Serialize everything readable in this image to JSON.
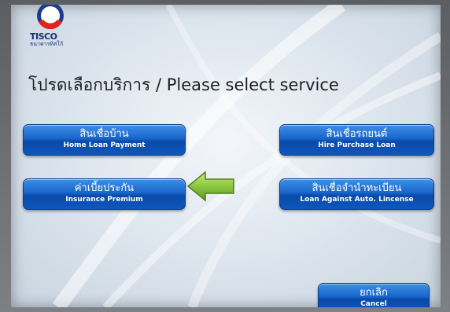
{
  "brand": {
    "name": "TISCO",
    "name_thai": "ธนาคารทิสโก้"
  },
  "header": {
    "title": "โปรดเลือกบริการ / Please select service"
  },
  "services": [
    {
      "label_th": "สินเชื่อบ้าน",
      "label_en": "Home Loan Payment"
    },
    {
      "label_th": "สินเชื่อรถยนต์",
      "label_en": "Hire Purchase Loan"
    },
    {
      "label_th": "ค่าเบี้ยประกัน",
      "label_en": "Insurance Premium"
    },
    {
      "label_th": "สินเชื่อจำนำทะเบียน",
      "label_en": "Loan Against Auto. Lincense"
    }
  ],
  "cancel": {
    "label_th": "ยกเลิก",
    "label_en": "Cancel"
  },
  "colors": {
    "button": "#1966cc",
    "arrow": "#8cc63f",
    "brand": "#17306f"
  },
  "icons": {
    "logo": "tisco-logo-icon",
    "pointer": "arrow-left-icon"
  }
}
